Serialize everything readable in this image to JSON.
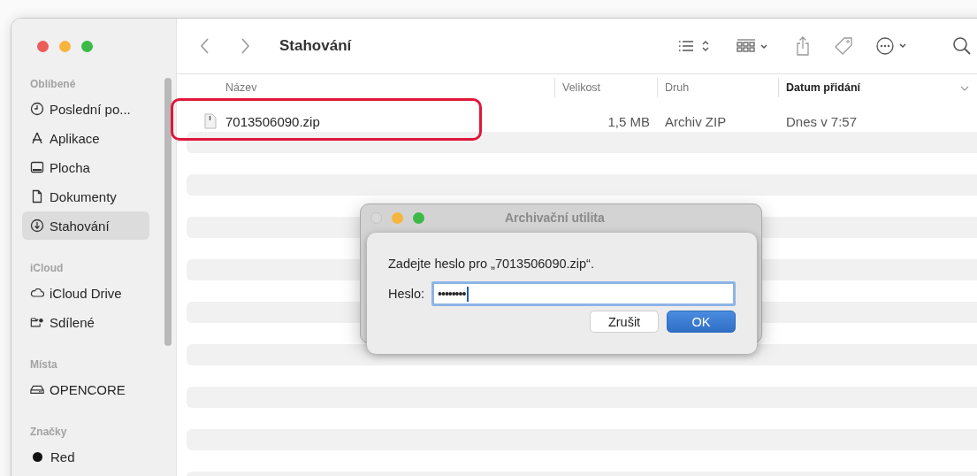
{
  "window": {
    "title": "Stahování"
  },
  "sidebar": {
    "sections": [
      {
        "heading": "Oblíbené",
        "items": [
          {
            "label": "Poslední po...",
            "kind": "recent",
            "selected": false
          },
          {
            "label": "Aplikace",
            "kind": "apps",
            "selected": false
          },
          {
            "label": "Plocha",
            "kind": "desktop",
            "selected": false
          },
          {
            "label": "Dokumenty",
            "kind": "document",
            "selected": false
          },
          {
            "label": "Stahování",
            "kind": "download",
            "selected": true
          }
        ]
      },
      {
        "heading": "iCloud",
        "items": [
          {
            "label": "iCloud Drive",
            "kind": "cloud",
            "selected": false
          },
          {
            "label": "Sdílené",
            "kind": "shared",
            "selected": false
          }
        ]
      },
      {
        "heading": "Místa",
        "items": [
          {
            "label": "OPENCORE",
            "kind": "drive",
            "selected": false
          }
        ]
      },
      {
        "heading": "Značky",
        "items": [
          {
            "label": "Red",
            "kind": "tag",
            "color": "#111111",
            "selected": false
          }
        ]
      }
    ]
  },
  "table": {
    "columns": [
      {
        "label": "Název",
        "sorted": false
      },
      {
        "label": "Velikost",
        "sorted": false
      },
      {
        "label": "Druh",
        "sorted": false
      },
      {
        "label": "Datum přidání",
        "sorted": true
      }
    ],
    "rows": [
      {
        "name": "7013506090.zip",
        "size": "1,5 MB",
        "kind": "Archiv ZIP",
        "date": "Dnes v 7:57",
        "highlighted": true
      }
    ]
  },
  "dialog": {
    "title": "Archivační utilita",
    "message": "Zadejte heslo pro „7013506090.zip“.",
    "field_label": "Heslo:",
    "field_value": "••••••••",
    "buttons": [
      {
        "label": "Zrušit",
        "default": false
      },
      {
        "label": "OK",
        "default": true
      }
    ]
  }
}
